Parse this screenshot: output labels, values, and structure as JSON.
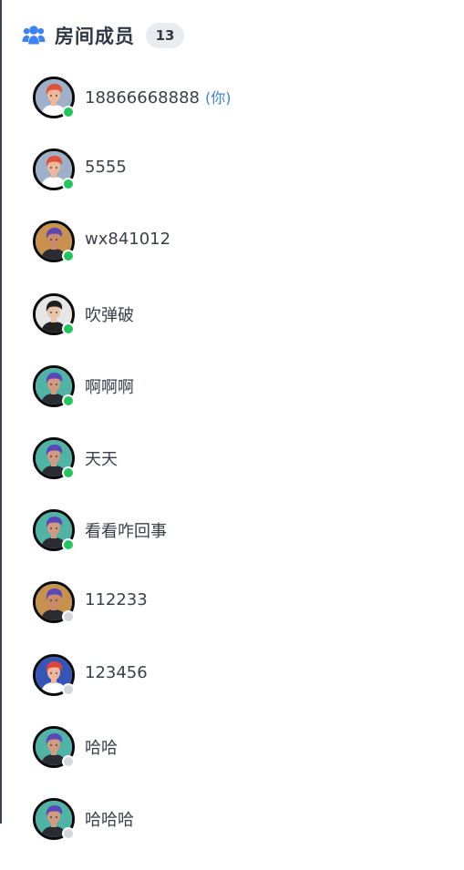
{
  "header": {
    "icon": "users-icon",
    "title": "房间成员",
    "count": "13"
  },
  "colors": {
    "online": "#22c55e",
    "offline": "#d4d7dc",
    "accent": "#3b82f6",
    "you_tag": "#3b82d6"
  },
  "members": [
    {
      "name": "18866668888",
      "tag": "(你)",
      "online": true,
      "avatar": "red-hair-avatar",
      "bg": "#9fb0c9",
      "hair": "#e0533a",
      "skin": "#f0b89a",
      "shirt": "#ffffff"
    },
    {
      "name": "5555",
      "tag": "",
      "online": true,
      "avatar": "red-hair-avatar",
      "bg": "#9fb0c9",
      "hair": "#e0533a",
      "skin": "#f0b89a",
      "shirt": "#ffffff"
    },
    {
      "name": "wx841012",
      "tag": "",
      "online": true,
      "avatar": "purple-hair-avatar",
      "bg": "#c8924e",
      "hair": "#5a47b8",
      "skin": "#c98a6a",
      "shirt": "#2b2b33"
    },
    {
      "name": "吹弹破",
      "tag": "",
      "online": true,
      "avatar": "dark-hair-avatar",
      "bg": "#e6e6e6",
      "hair": "#1d1d1d",
      "skin": "#e9c3a8",
      "shirt": "#222222"
    },
    {
      "name": "啊啊啊",
      "tag": "",
      "online": true,
      "avatar": "purple-hair-avatar",
      "bg": "#4fb3a6",
      "hair": "#5a47b8",
      "skin": "#d29a80",
      "shirt": "#2b2b33"
    },
    {
      "name": "天天",
      "tag": "",
      "online": true,
      "avatar": "purple-hair-avatar",
      "bg": "#4fb3a6",
      "hair": "#5a47b8",
      "skin": "#d29a80",
      "shirt": "#2b2b33"
    },
    {
      "name": "看看咋回事",
      "tag": "",
      "online": true,
      "avatar": "purple-hair-avatar",
      "bg": "#4fb3a6",
      "hair": "#5a47b8",
      "skin": "#d29a80",
      "shirt": "#2b2b33"
    },
    {
      "name": "112233",
      "tag": "",
      "online": false,
      "avatar": "purple-hair-avatar",
      "bg": "#c8924e",
      "hair": "#5a47b8",
      "skin": "#c98a6a",
      "shirt": "#2b2b33"
    },
    {
      "name": "123456",
      "tag": "",
      "online": false,
      "avatar": "red-hair-avatar",
      "bg": "#3556b8",
      "hair": "#e0443a",
      "skin": "#f0b89a",
      "shirt": "#ffffff"
    },
    {
      "name": "哈哈",
      "tag": "",
      "online": false,
      "avatar": "purple-hair-avatar",
      "bg": "#4fb3a6",
      "hair": "#5a47b8",
      "skin": "#d29a80",
      "shirt": "#2b2b33"
    },
    {
      "name": "哈哈哈",
      "tag": "",
      "online": false,
      "avatar": "purple-hair-avatar",
      "bg": "#4fb3a6",
      "hair": "#5a47b8",
      "skin": "#d29a80",
      "shirt": "#2b2b33"
    }
  ]
}
